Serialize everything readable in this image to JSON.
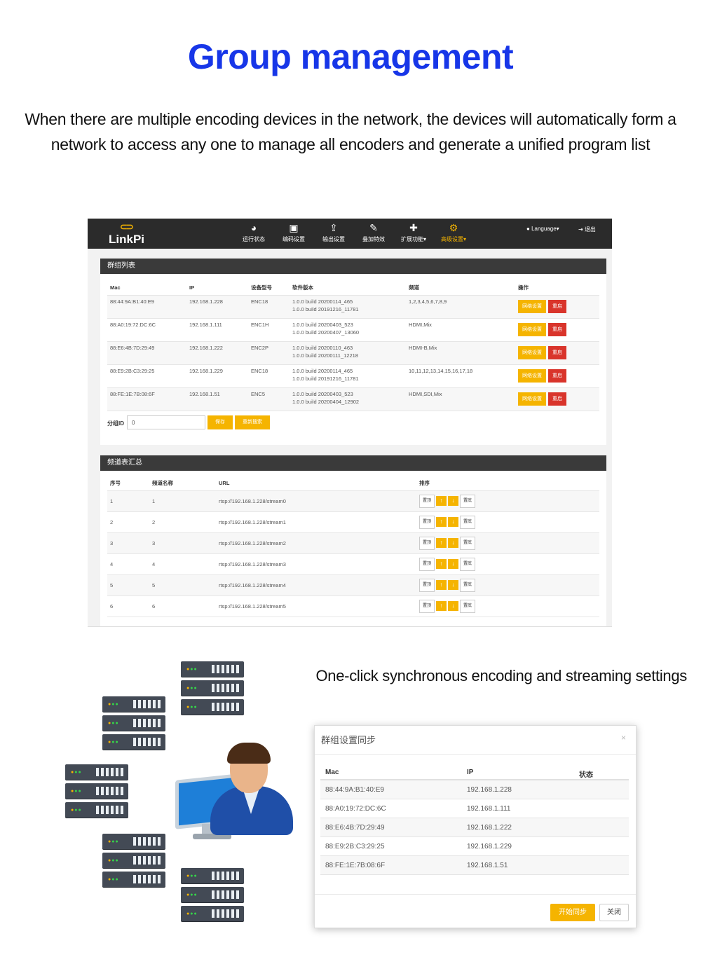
{
  "hero": {
    "title": "Group management",
    "description": "When there are multiple encoding devices in the network, the devices will automatically form a network to access any one to manage all encoders and generate a unified program list"
  },
  "app": {
    "logo": "LinkPi",
    "nav": [
      {
        "icon": "dashboard-icon",
        "label": "运行状态"
      },
      {
        "icon": "image-icon",
        "label": "编码设置"
      },
      {
        "icon": "upload-icon",
        "label": "输出设置"
      },
      {
        "icon": "magic-wand-icon",
        "label": "叠加特效"
      },
      {
        "icon": "puzzle-icon",
        "label": "扩展功能▾"
      },
      {
        "icon": "gears-icon",
        "label": "高级设置▾"
      }
    ],
    "language": "Language▾",
    "logout": "退出",
    "group_list": {
      "title": "群组列表",
      "columns": [
        "Mac",
        "IP",
        "设备型号",
        "软件版本",
        "频道",
        "操作"
      ],
      "rows": [
        {
          "mac": "88:44:9A:B1:40:E9",
          "ip": "192.168.1.228",
          "model": "ENC18",
          "ver1": "1.0.0 build 20200114_465",
          "ver2": "1.0.0 build 20191216_11781",
          "channels": "1,2,3,4,5,6,7,8,9"
        },
        {
          "mac": "88:A0:19:72:DC:6C",
          "ip": "192.168.1.111",
          "model": "ENC1H",
          "ver1": "1.0.0 build 20200403_523",
          "ver2": "1.0.0 build 20200407_13060",
          "channels": "HDMI,Mix"
        },
        {
          "mac": "88:E6:4B:7D:29:49",
          "ip": "192.168.1.222",
          "model": "ENC2P",
          "ver1": "1.0.0 build 20200110_463",
          "ver2": "1.0.0 build 20200111_12218",
          "channels": "HDMI-B,Mix"
        },
        {
          "mac": "88:E9:2B:C3:29:25",
          "ip": "192.168.1.229",
          "model": "ENC18",
          "ver1": "1.0.0 build 20200114_465",
          "ver2": "1.0.0 build 20191216_11781",
          "channels": "10,11,12,13,14,15,16,17,18"
        },
        {
          "mac": "88:FE:1E:7B:08:6F",
          "ip": "192.168.1.51",
          "model": "ENC5",
          "ver1": "1.0.0 build 20200403_523",
          "ver2": "1.0.0 build 20200404_12902",
          "channels": "HDMI,SDI,Mix"
        }
      ],
      "row_btn_network": "网络设置",
      "row_btn_restart": "重启",
      "group_id_label": "分组ID",
      "group_id_value": "0",
      "save_label": "保存",
      "rescan_label": "重新搜索"
    },
    "channel_summary": {
      "title": "频道表汇总",
      "columns": [
        "序号",
        "频道名称",
        "URL",
        "排序"
      ],
      "rows": [
        {
          "no": "1",
          "name": "1",
          "url": "rtsp://192.168.1.228/stream0"
        },
        {
          "no": "2",
          "name": "2",
          "url": "rtsp://192.168.1.228/stream1"
        },
        {
          "no": "3",
          "name": "3",
          "url": "rtsp://192.168.1.228/stream2"
        },
        {
          "no": "4",
          "name": "4",
          "url": "rtsp://192.168.1.228/stream3"
        },
        {
          "no": "5",
          "name": "5",
          "url": "rtsp://192.168.1.228/stream4"
        },
        {
          "no": "6",
          "name": "6",
          "url": "rtsp://192.168.1.228/stream5"
        }
      ],
      "btn_top": "置顶",
      "btn_up": "↑",
      "btn_down": "↓",
      "btn_bottom": "置底"
    }
  },
  "subtitle": "One-click synchronous encoding and streaming settings",
  "dialog": {
    "title": "群组设置同步",
    "close_icon": "×",
    "columns": [
      "Mac",
      "IP",
      "状态"
    ],
    "rows": [
      {
        "mac": "88:44:9A:B1:40:E9",
        "ip": "192.168.1.228"
      },
      {
        "mac": "88:A0:19:72:DC:6C",
        "ip": "192.168.1.111"
      },
      {
        "mac": "88:E6:4B:7D:29:49",
        "ip": "192.168.1.222"
      },
      {
        "mac": "88:E9:2B:C3:29:25",
        "ip": "192.168.1.229"
      },
      {
        "mac": "88:FE:1E:7B:08:6F",
        "ip": "192.168.1.51"
      }
    ],
    "start_sync": "开始同步",
    "close": "关闭"
  },
  "colors": {
    "brand_blue": "#1736e8",
    "accent_yellow": "#f5b400",
    "danger_red": "#d9342b",
    "navbar": "#2b2b2b"
  }
}
